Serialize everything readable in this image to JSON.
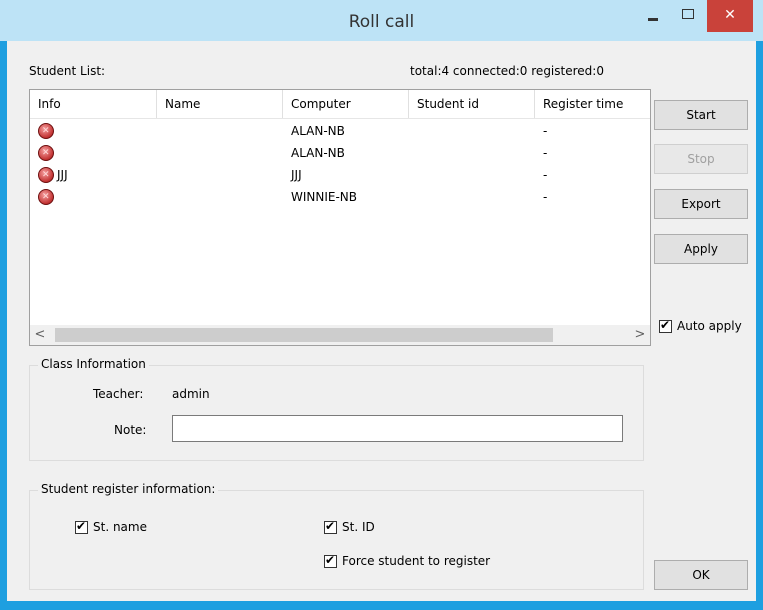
{
  "window": {
    "title": "Roll call",
    "close_glyph": "✕"
  },
  "summary": {
    "student_list_label": "Student List:",
    "counts": "total:4  connected:0   registered:0"
  },
  "table": {
    "columns": [
      "Info",
      "Name",
      "Computer",
      "Student id",
      "Register time"
    ],
    "rows": [
      {
        "status_icon": "disconnected-icon",
        "info": "",
        "name": "",
        "computer": "ALAN-NB",
        "student_id": "",
        "register_time": "-"
      },
      {
        "status_icon": "disconnected-icon",
        "info": "",
        "name": "",
        "computer": "ALAN-NB",
        "student_id": "",
        "register_time": "-"
      },
      {
        "status_icon": "disconnected-icon",
        "info": "JJJ",
        "name": "",
        "computer": "JJJ",
        "student_id": "",
        "register_time": "-"
      },
      {
        "status_icon": "disconnected-icon",
        "info": "",
        "name": "",
        "computer": "WINNIE-NB",
        "student_id": "",
        "register_time": "-"
      }
    ],
    "scroll_left": "<",
    "scroll_right": ">"
  },
  "buttons": {
    "start": "Start",
    "stop": "Stop",
    "export": "Export",
    "apply": "Apply",
    "ok": "OK"
  },
  "auto_apply": {
    "label": "Auto apply",
    "checked": true
  },
  "class_info": {
    "title": "Class Information",
    "teacher_label": "Teacher:",
    "teacher_value": "admin",
    "note_label": "Note:",
    "note_value": ""
  },
  "register_info": {
    "title": "Student register information:",
    "st_name": {
      "label": "St. name",
      "checked": true
    },
    "st_id": {
      "label": "St. ID",
      "checked": true
    },
    "force": {
      "label": "Force student to register",
      "checked": true
    }
  },
  "colors": {
    "title_bar": "#bde3f6",
    "window_border": "#1e9fe0",
    "close_button": "#c9423a",
    "status_icon": "#c23232"
  }
}
